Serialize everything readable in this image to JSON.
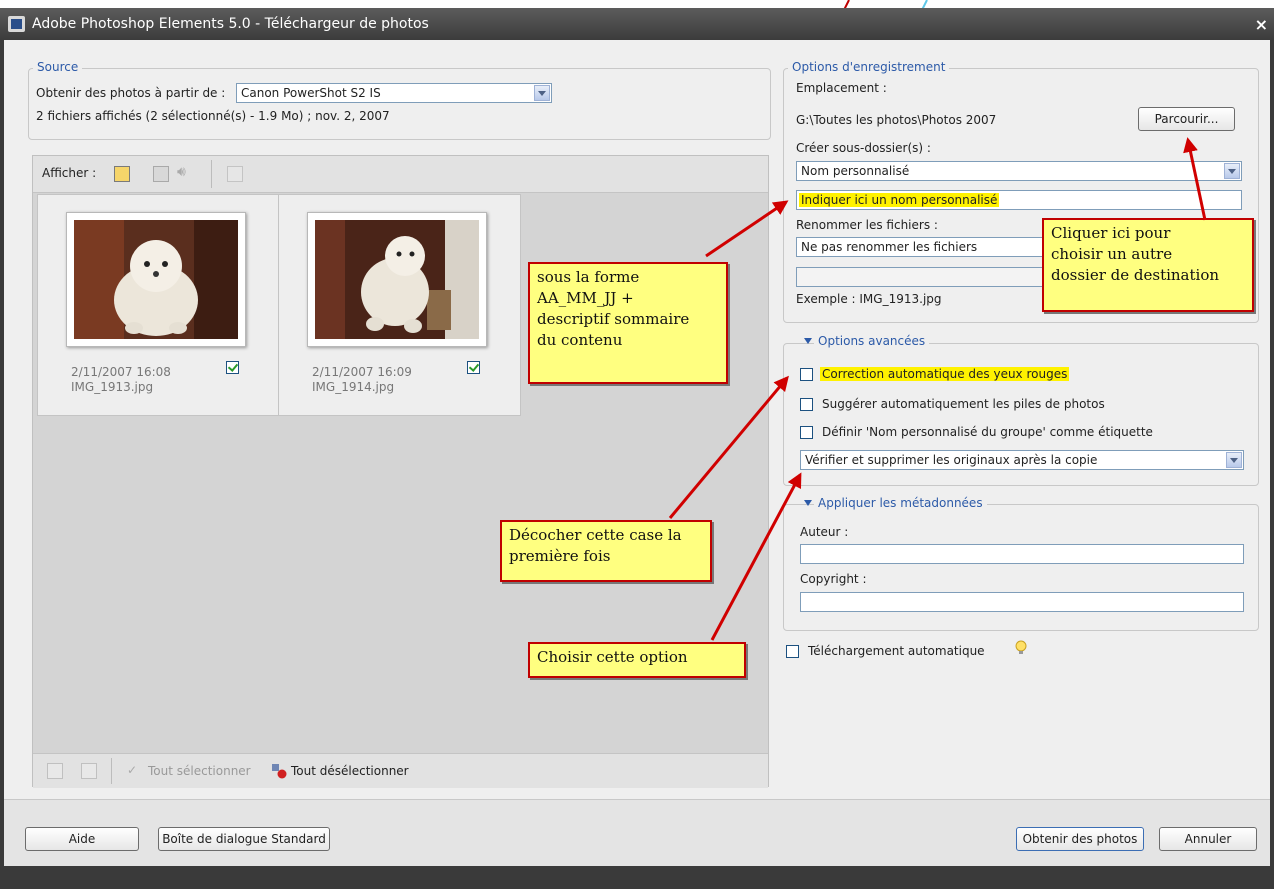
{
  "window": {
    "title": "Adobe Photoshop Elements 5.0 - Téléchargeur de photos",
    "close_label": "×"
  },
  "source": {
    "legend": "Source",
    "obtain_label": "Obtenir des photos à partir de :",
    "device_value": "Canon PowerShot S2 IS",
    "file_info": "2 fichiers affichés (2 sélectionné(s) - 1.9 Mo) ; nov. 2, 2007"
  },
  "photos": {
    "show_label": "Afficher :",
    "items": [
      {
        "date": "2/11/2007 16:08",
        "filename": "IMG_1913.jpg",
        "checked": true
      },
      {
        "date": "2/11/2007 16:09",
        "filename": "IMG_1914.jpg",
        "checked": true
      }
    ],
    "select_all_label": "Tout sélectionner",
    "deselect_all_label": "Tout désélectionner"
  },
  "save_options": {
    "legend": "Options d'enregistrement",
    "location_label": "Emplacement :",
    "location_path": "G:\\Toutes les photos\\Photos 2007",
    "browse_label": "Parcourir...",
    "subfolder_label": "Créer sous-dossier(s) :",
    "subfolder_value": "Nom personnalisé",
    "custom_name_value": "Indiquer ici un nom personnalisé",
    "rename_label": "Renommer les fichiers :",
    "rename_value": "Ne pas renommer les fichiers",
    "example_text": "Exemple :  IMG_1913.jpg"
  },
  "advanced": {
    "legend": "Options avancées",
    "red_eye_label": "Correction automatique des yeux rouges",
    "suggest_stacks_label": "Suggérer automatiquement les piles de photos",
    "group_tag_label": "Définir 'Nom personnalisé du groupe' comme étiquette",
    "delete_option_value": "Vérifier et supprimer les originaux après la copie"
  },
  "metadata": {
    "legend": "Appliquer les métadonnées",
    "author_label": "Auteur :",
    "author_value": "",
    "copyright_label": "Copyright :",
    "copyright_value": ""
  },
  "auto_download_label": "Téléchargement automatique",
  "footer_buttons": {
    "help": "Aide",
    "standard_dialog": "Boîte de dialogue Standard",
    "get_photos": "Obtenir des photos",
    "cancel": "Annuler"
  },
  "annotations": {
    "naming": [
      "sous la forme",
      "AA_MM_JJ +",
      "descriptif sommaire",
      "du contenu"
    ],
    "browse": [
      "Cliquer ici pour",
      "choisir un autre",
      "dossier de destination"
    ],
    "uncheck": [
      "Décocher cette case la",
      "première fois"
    ],
    "choose": [
      "Choisir cette option"
    ]
  },
  "colors": {
    "legend_blue": "#2c5aa8",
    "highlight_yellow": "#fff200",
    "note_yellow": "#ffff80",
    "arrow_red": "#d00000"
  }
}
